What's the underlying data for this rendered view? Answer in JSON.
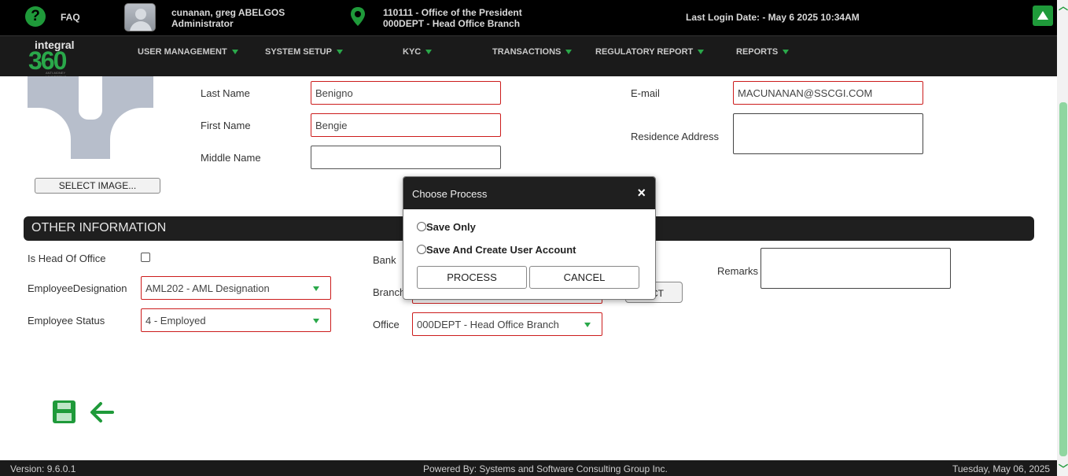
{
  "topbar": {
    "faq_label": "FAQ",
    "user_name": "cunanan, greg ABELGOS",
    "user_role": "Administrator",
    "office_line1": "110111 - Office of the President",
    "office_line2": "000DEPT - Head Office Branch",
    "last_login": "Last Login Date: - May 6 2025 10:34AM"
  },
  "logo": {
    "line1": "integral",
    "line2": "360",
    "tagline": "ANTI-MONEY LAUNDERING"
  },
  "nav": {
    "user_management": "USER MANAGEMENT",
    "system_setup": "SYSTEM SETUP",
    "kyc": "KYC",
    "transactions": "TRANSACTIONS",
    "regulatory_report": "REGULATORY REPORT",
    "reports": "REPORTS"
  },
  "form": {
    "select_image": "SELECT IMAGE...",
    "last_name_label": "Last Name",
    "last_name_value": "Benigno",
    "first_name_label": "First Name",
    "first_name_value": "Bengie",
    "middle_name_label": "Middle Name",
    "middle_name_value": "",
    "email_label": "E-mail",
    "email_value": "MACUNANAN@SSCGI.COM",
    "residence_label": "Residence Address"
  },
  "other": {
    "section_title": "OTHER INFORMATION",
    "head_office_label": "Is Head Of Office",
    "designation_label": "EmployeeDesignation",
    "designation_value": "AML202 - AML Designation",
    "status_label": "Employee Status",
    "status_value": "4 - Employed",
    "bank_label": "Bank",
    "branch_label": "Branch",
    "office_label": "Office",
    "office_value": "000DEPT - Head Office Branch",
    "select_partial": "ECT",
    "remarks_label": "Remarks"
  },
  "dialog": {
    "title": "Choose Process",
    "close": "×",
    "option1": "Save Only",
    "option2": "Save And Create User Account",
    "process": "PROCESS",
    "cancel": "CANCEL"
  },
  "footer": {
    "version": "Version: 9.6.0.1",
    "powered": "Powered By: Systems and Software Consulting Group Inc.",
    "date": "Tuesday, May 06, 2025"
  },
  "colors": {
    "accent_green": "#1f9a3a",
    "error_border": "#cc1c1c",
    "header_bg": "#000000"
  }
}
